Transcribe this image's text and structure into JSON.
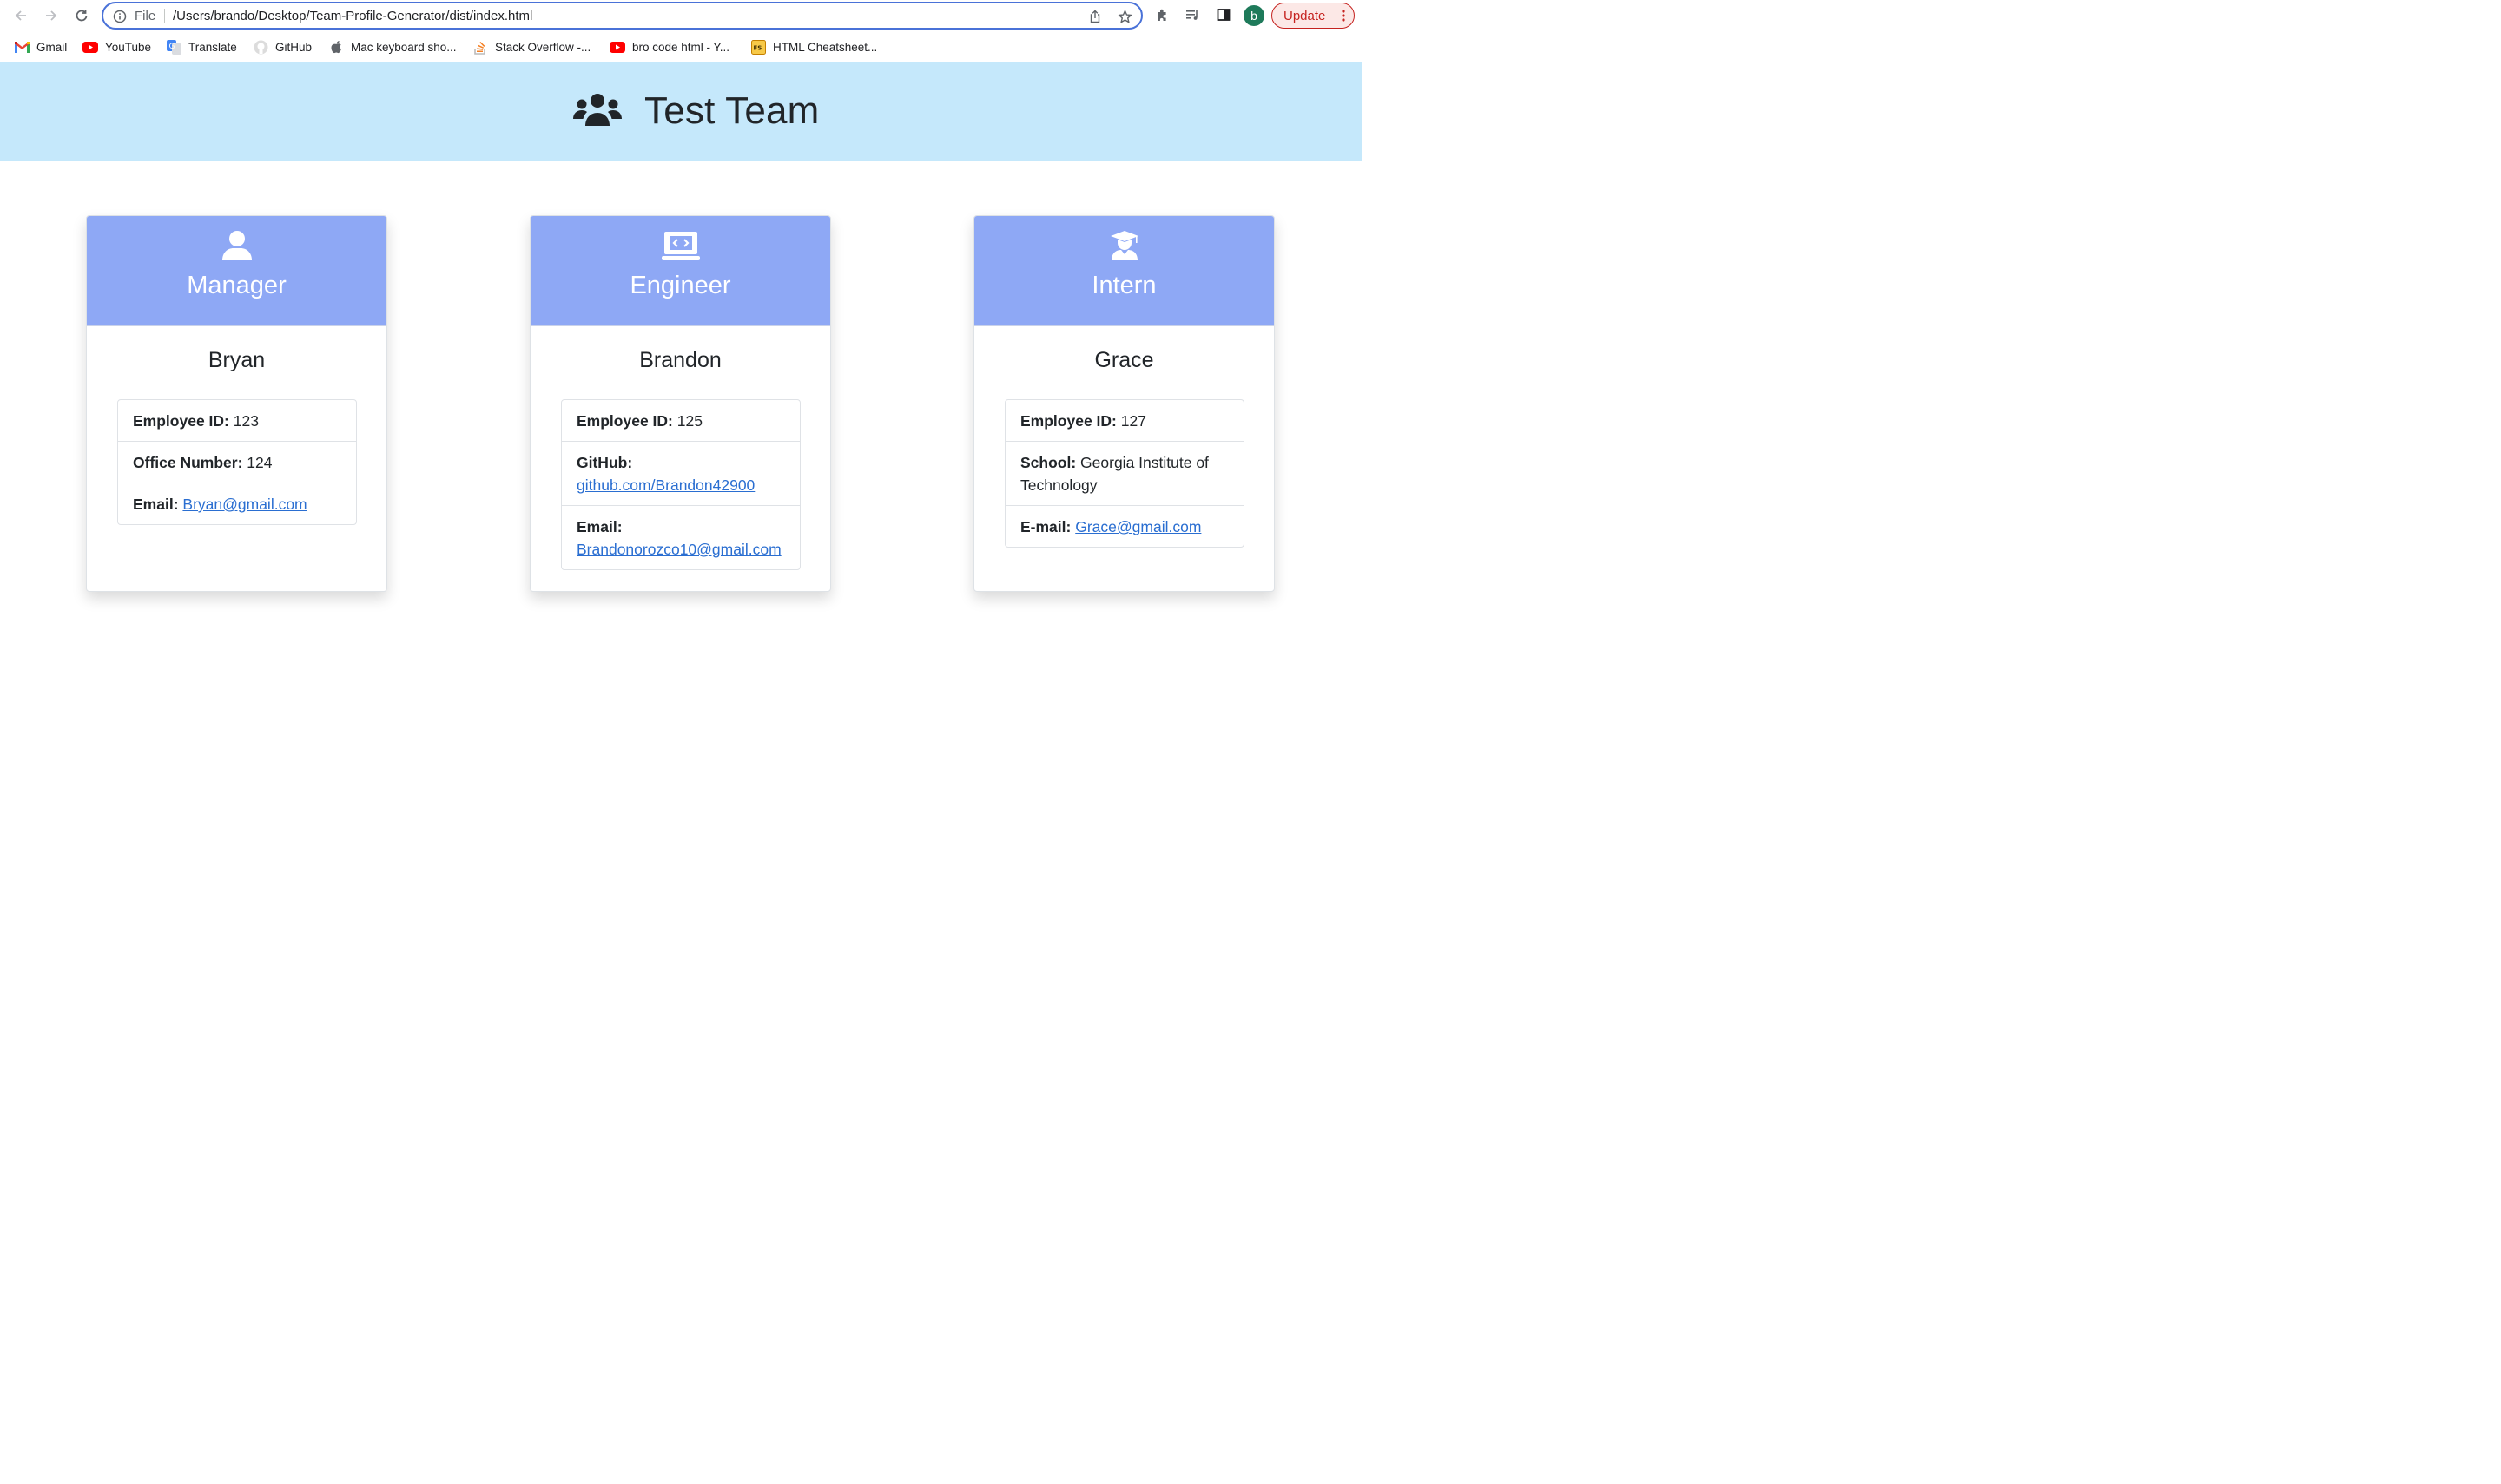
{
  "browser": {
    "omnibox": {
      "scheme_label": "File",
      "url": "/Users/brando/Desktop/Team-Profile-Generator/dist/index.html"
    },
    "profile_initial": "b",
    "update_label": "Update",
    "bookmarks": [
      {
        "label": "Gmail",
        "icon": "gmail-icon"
      },
      {
        "label": "YouTube",
        "icon": "youtube-icon"
      },
      {
        "label": "Translate",
        "icon": "translate-icon"
      },
      {
        "label": "GitHub",
        "icon": "github-icon"
      },
      {
        "label": "Mac keyboard sho...",
        "icon": "apple-icon"
      },
      {
        "label": "Stack Overflow -...",
        "icon": "stackoverflow-icon"
      },
      {
        "label": "bro code html - Y...",
        "icon": "youtube-icon"
      },
      {
        "label": "HTML Cheatsheet...",
        "icon": "cheatsheet-icon"
      }
    ]
  },
  "page": {
    "team_name": "Test Team",
    "team_icon": "users-icon",
    "cards": [
      {
        "role": "Manager",
        "icon": "person-icon",
        "name": "Bryan",
        "rows": [
          {
            "label": "Employee ID:",
            "value": "123"
          },
          {
            "label": "Office Number:",
            "value": "124"
          },
          {
            "label": "Email:",
            "link": "Bryan@gmail.com"
          }
        ]
      },
      {
        "role": "Engineer",
        "icon": "laptop-code-icon",
        "name": "Brandon",
        "rows": [
          {
            "label": "Employee ID:",
            "value": "125"
          },
          {
            "label": "GitHub:",
            "link": "github.com/Brandon42900"
          },
          {
            "label": "Email:",
            "link": "Brandonorozco10@gmail.com"
          }
        ]
      },
      {
        "role": "Intern",
        "icon": "graduate-icon",
        "name": "Grace",
        "rows": [
          {
            "label": "Employee ID:",
            "value": "127"
          },
          {
            "label": "School:",
            "value": "Georgia Institute of Technology"
          },
          {
            "label": "E-mail:",
            "link": "Grace@gmail.com"
          }
        ]
      }
    ]
  },
  "colors": {
    "header_bg": "#c5e8fb",
    "card_header_bg": "#8ea8f5",
    "link": "#2a6ed1",
    "omnibox_border": "#4a72d8",
    "update_red": "#c5221f"
  }
}
